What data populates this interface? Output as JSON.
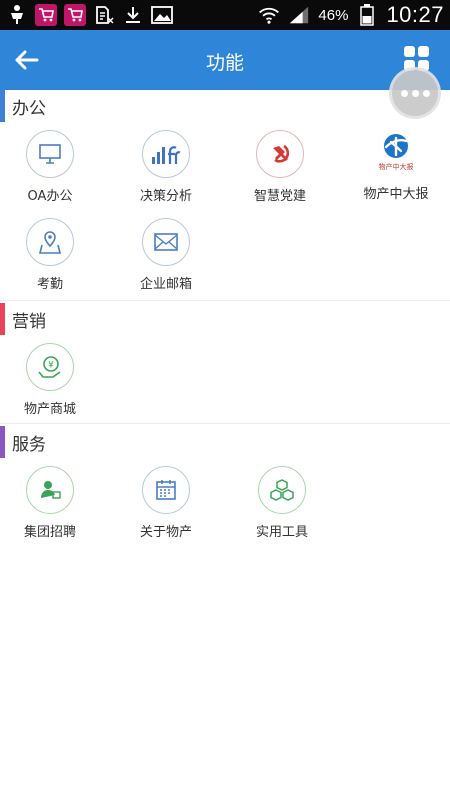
{
  "status_bar": {
    "icons": [
      "usb-debug-icon",
      "cart-icon",
      "cart-icon",
      "sim-icon",
      "download-icon",
      "image-icon"
    ],
    "battery_text": "46%",
    "time": "10:27"
  },
  "header": {
    "title": "功能",
    "accent_color": "#2f86d8"
  },
  "sections": [
    {
      "title": "办公",
      "bar_color": "#3b7fd6",
      "items": [
        {
          "label": "OA办公",
          "icon": "monitor-icon"
        },
        {
          "label": "决策分析",
          "icon": "bar-chart-icon"
        },
        {
          "label": "智慧党建",
          "icon": "party-emblem-icon"
        },
        {
          "label": "物产中大报",
          "icon": "newspaper-logo-icon",
          "logo_text": "物产中大报"
        },
        {
          "label": "考勤",
          "icon": "location-map-icon"
        },
        {
          "label": "企业邮箱",
          "icon": "mail-icon"
        }
      ]
    },
    {
      "title": "营销",
      "bar_color": "#e9425a",
      "items": [
        {
          "label": "物产商城",
          "icon": "yuan-coin-hand-icon"
        }
      ]
    },
    {
      "title": "服务",
      "bar_color": "#8a57c2",
      "items": [
        {
          "label": "集团招聘",
          "icon": "recruit-person-icon"
        },
        {
          "label": "关于物产",
          "icon": "calendar-icon"
        },
        {
          "label": "实用工具",
          "icon": "cubes-icon"
        }
      ]
    }
  ]
}
